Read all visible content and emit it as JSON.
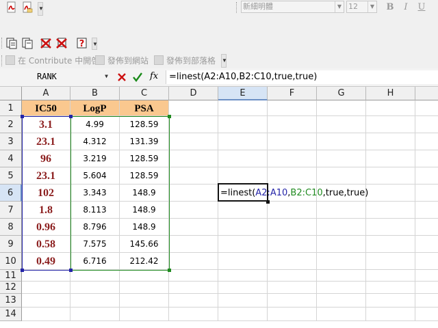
{
  "font_toolbar": {
    "font_name": "新細明體",
    "font_size": "12",
    "bold_label": "B",
    "italic_label": "I",
    "underline_label": "U"
  },
  "contribute_toolbar": {
    "items": [
      {
        "label": "在 Contribute 中開啓"
      },
      {
        "label": "發佈到網站"
      },
      {
        "label": "發佈到部落格"
      }
    ]
  },
  "formula_bar": {
    "name_box": "RANK",
    "fx_label": "fx",
    "formula": "=linest(A2:A10,B2:C10,true,true)"
  },
  "columns": [
    "A",
    "B",
    "C",
    "D",
    "E",
    "F",
    "G",
    "H"
  ],
  "rows": [
    "1",
    "2",
    "3",
    "4",
    "5",
    "6",
    "7",
    "8",
    "9",
    "10",
    "11",
    "12",
    "13",
    "14"
  ],
  "table": {
    "headers": [
      "IC50",
      "LogP",
      "PSA"
    ],
    "ic50": [
      "3.1",
      "23.1",
      "96",
      "23.1",
      "102",
      "1.8",
      "0.96",
      "0.58",
      "0.49"
    ],
    "logp": [
      "4.99",
      "4.312",
      "3.219",
      "5.604",
      "3.343",
      "8.113",
      "8.796",
      "7.575",
      "6.716"
    ],
    "psa": [
      "128.59",
      "131.39",
      "128.59",
      "128.59",
      "148.9",
      "148.9",
      "148.9",
      "145.66",
      "212.42"
    ]
  },
  "active_cell": {
    "column": "E",
    "row": "6",
    "text_prefix": "=linest(",
    "ref_a": "A2:A10",
    "comma1": ",",
    "ref_b": "B2:C10",
    "text_suffix": ",true,true)"
  },
  "colors": {
    "header_fill": "#fac88f",
    "ic50_text": "#8b1d1d",
    "ref_a_border": "#2424a8",
    "ref_b_border": "#1f8a1f",
    "cancel_icon": "#cc1111",
    "enter_icon": "#1a8a1a"
  }
}
